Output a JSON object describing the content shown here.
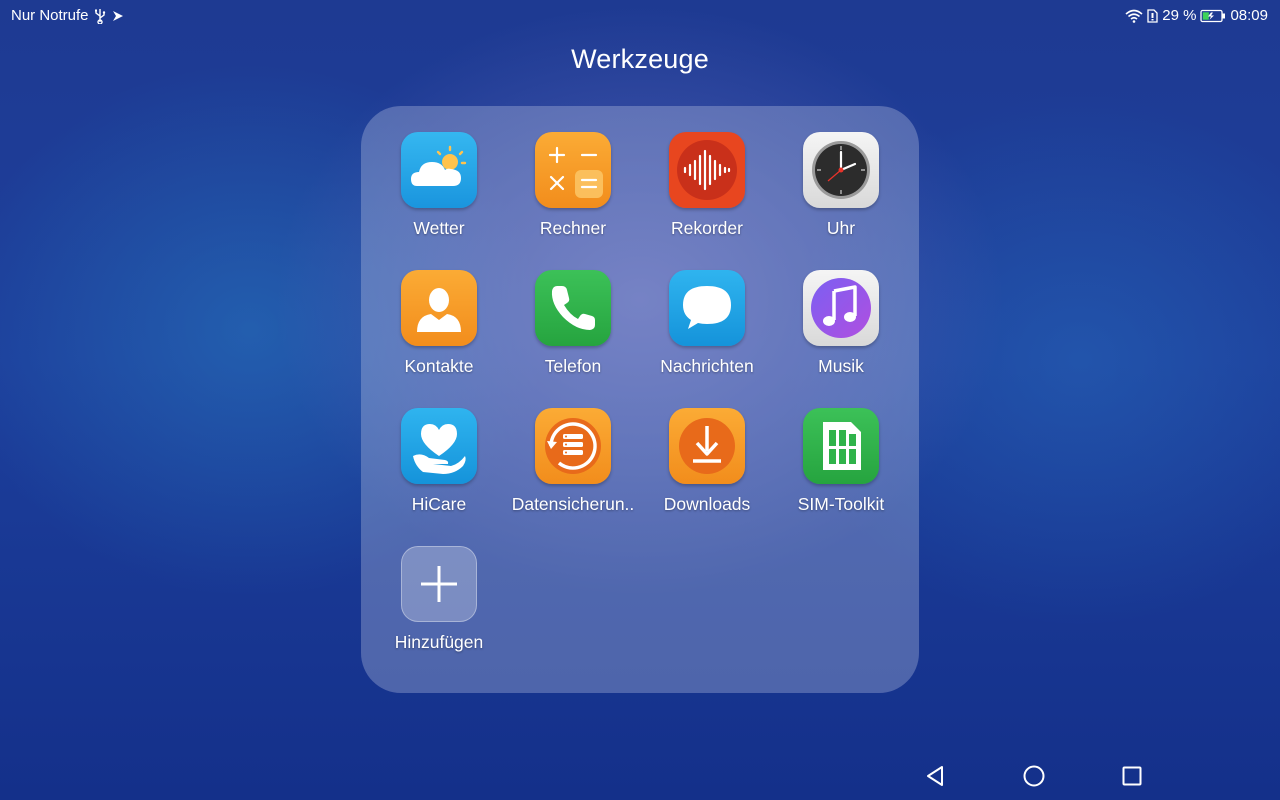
{
  "status_bar": {
    "carrier_text": "Nur Notrufe",
    "battery_percent": "29 %",
    "time": "08:09",
    "icons": [
      "usb-icon",
      "notification-icon",
      "wifi-icon",
      "sim-icon",
      "battery-icon"
    ]
  },
  "folder": {
    "title": "Werkzeuge",
    "apps": [
      {
        "label": "Wetter",
        "icon": "weather-icon",
        "color": "#29a9e8"
      },
      {
        "label": "Rechner",
        "icon": "calculator-icon",
        "color": "#f59a23"
      },
      {
        "label": "Rekorder",
        "icon": "recorder-icon",
        "color": "#e8461f"
      },
      {
        "label": "Uhr",
        "icon": "clock-icon",
        "color": "#e8e8e8"
      },
      {
        "label": "Kontakte",
        "icon": "contacts-icon",
        "color": "#f59a23"
      },
      {
        "label": "Telefon",
        "icon": "phone-icon",
        "color": "#2fb34a"
      },
      {
        "label": "Nachrichten",
        "icon": "messages-icon",
        "color": "#1da3e6"
      },
      {
        "label": "Musik",
        "icon": "music-icon",
        "color": "#e8e8e8"
      },
      {
        "label": "HiCare",
        "icon": "hicare-icon",
        "color": "#1da3e6"
      },
      {
        "label": "Datensicherun..",
        "icon": "backup-icon",
        "color": "#f59a23"
      },
      {
        "label": "Downloads",
        "icon": "download-icon",
        "color": "#f59a23"
      },
      {
        "label": "SIM-Toolkit",
        "icon": "sim-toolkit-icon",
        "color": "#2fb34a"
      },
      {
        "label": "Hinzufügen",
        "icon": "add-icon",
        "color": "#ffffff"
      }
    ]
  },
  "nav_bar": {
    "icons": [
      "back-icon",
      "home-icon",
      "recents-icon"
    ]
  }
}
